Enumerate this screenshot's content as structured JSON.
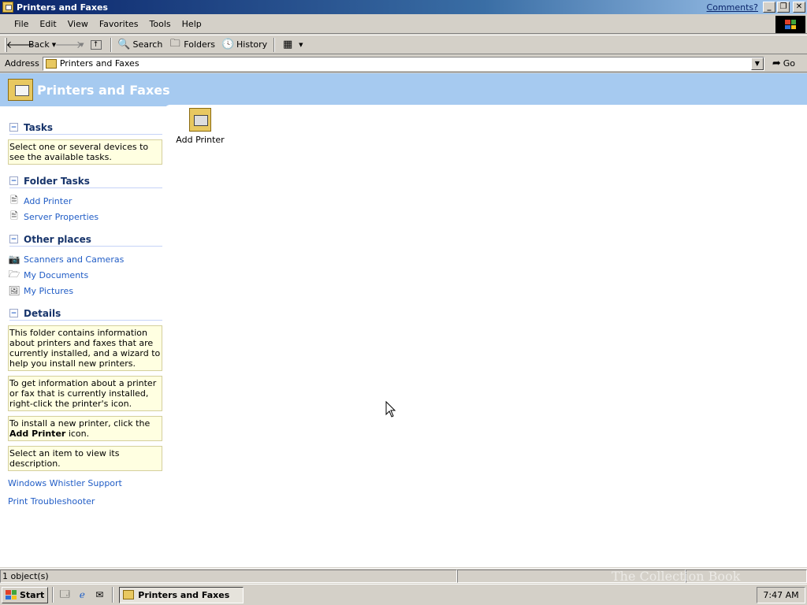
{
  "window": {
    "title": "Printers and Faxes",
    "comments_link": "Comments?"
  },
  "menu": [
    "File",
    "Edit",
    "View",
    "Favorites",
    "Tools",
    "Help"
  ],
  "toolbar": {
    "back": "Back",
    "search": "Search",
    "folders": "Folders",
    "history": "History"
  },
  "address": {
    "label": "Address",
    "value": "Printers and Faxes",
    "go": "Go"
  },
  "banner": {
    "title": "Printers and Faxes"
  },
  "tasks": {
    "title": "Tasks",
    "note": "Select one or several devices to see the available tasks."
  },
  "folder_tasks": {
    "title": "Folder Tasks",
    "items": [
      "Add Printer",
      "Server Properties"
    ]
  },
  "other_places": {
    "title": "Other places",
    "items": [
      "Scanners and Cameras",
      "My Documents",
      "My Pictures"
    ]
  },
  "details": {
    "title": "Details",
    "note1": "This folder contains information about printers and faxes that are currently installed, and a wizard to help you install new printers.",
    "note2": "To get information about a printer or fax that is currently installed, right-click the printer's icon.",
    "note3_pre": "To install a new printer, click the ",
    "note3_bold": "Add Printer",
    "note3_post": " icon.",
    "note4": "Select an item to view its description."
  },
  "links": {
    "support": "Windows Whistler Support",
    "troubleshooter": "Print Troubleshooter"
  },
  "main_items": [
    {
      "label": "Add Printer"
    }
  ],
  "status": {
    "objects": "1 object(s)"
  },
  "taskbar": {
    "start": "Start",
    "active_task": "Printers and Faxes",
    "clock": "7:47 AM"
  },
  "watermark": "The Collection Book"
}
